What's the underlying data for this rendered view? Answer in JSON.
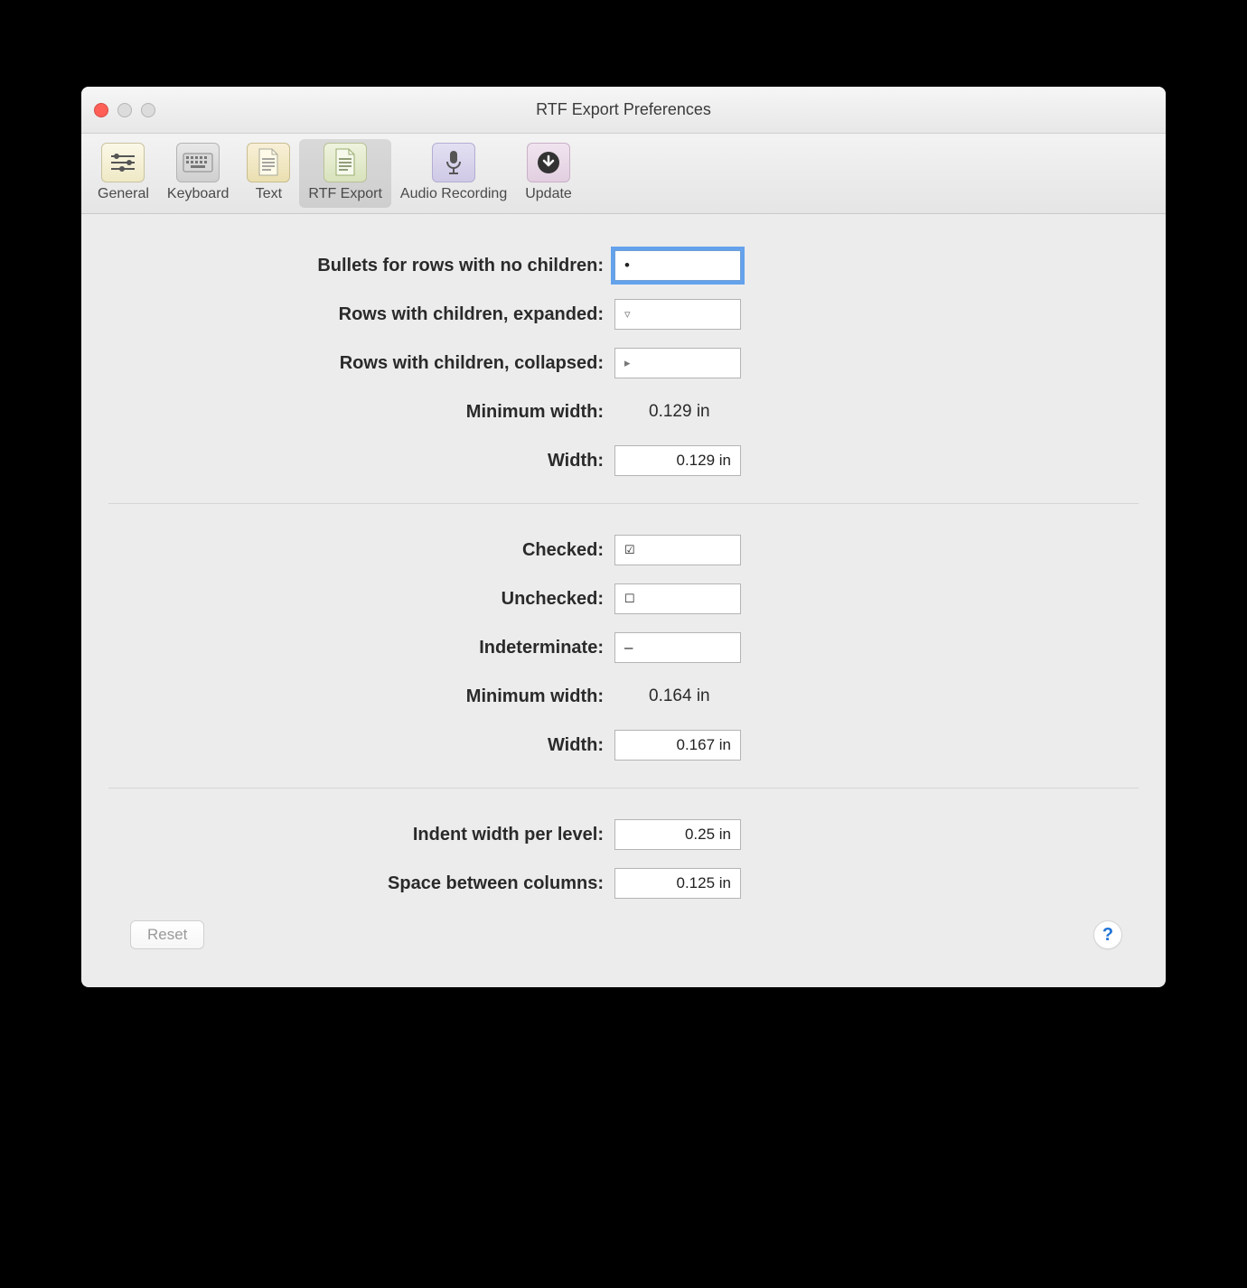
{
  "window": {
    "title": "RTF Export Preferences"
  },
  "toolbar": {
    "items": [
      {
        "label": "General"
      },
      {
        "label": "Keyboard"
      },
      {
        "label": "Text"
      },
      {
        "label": "RTF Export"
      },
      {
        "label": "Audio Recording"
      },
      {
        "label": "Update"
      }
    ],
    "active_index": 3
  },
  "section_bullets": {
    "labels": {
      "no_children": "Bullets for rows with no children:",
      "expanded": "Rows with children, expanded:",
      "collapsed": "Rows with children, collapsed:",
      "min_width": "Minimum width:",
      "width": "Width:"
    },
    "values": {
      "no_children": "•",
      "expanded": "▿",
      "collapsed": "▸",
      "min_width": "0.129 in",
      "width": "0.129 in"
    }
  },
  "section_checks": {
    "labels": {
      "checked": "Checked:",
      "unchecked": "Unchecked:",
      "indeterminate": "Indeterminate:",
      "min_width": "Minimum width:",
      "width": "Width:"
    },
    "values": {
      "checked": "☑",
      "unchecked": "☐",
      "indeterminate": "–",
      "min_width": "0.164 in",
      "width": "0.167 in"
    }
  },
  "section_layout": {
    "labels": {
      "indent": "Indent width per level:",
      "gap": "Space between columns:"
    },
    "values": {
      "indent": "0.25 in",
      "gap": "0.125 in"
    }
  },
  "footer": {
    "reset": "Reset",
    "help": "?"
  }
}
